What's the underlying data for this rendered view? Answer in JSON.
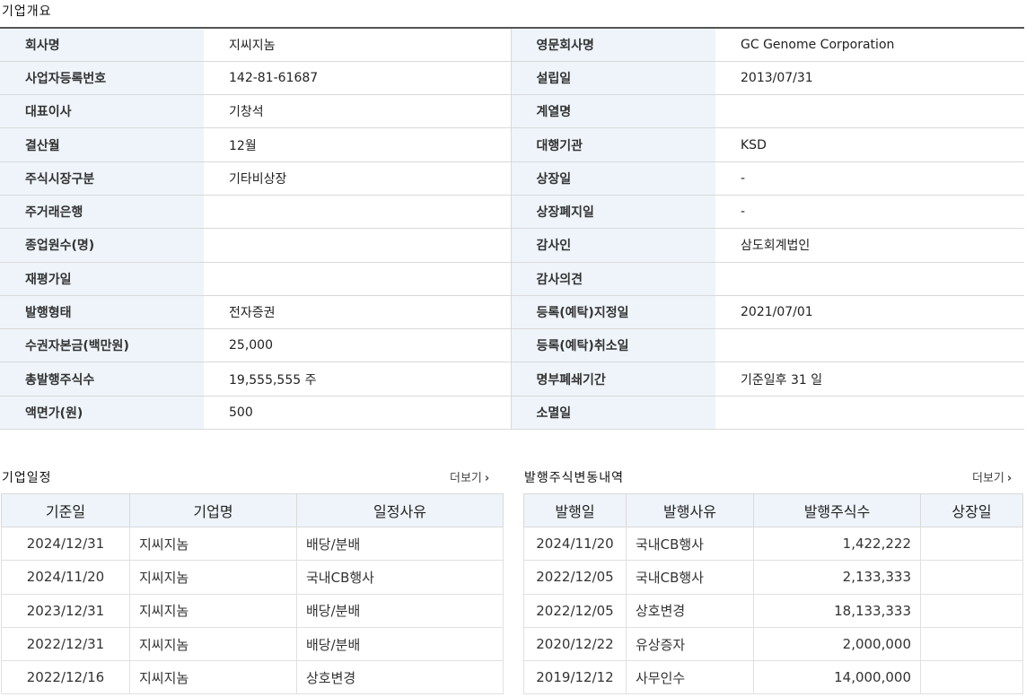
{
  "overview": {
    "title": "기업개요",
    "rows": [
      {
        "l1": "회사명",
        "v1": "지씨지놈",
        "l2": "영문회사명",
        "v2": "GC Genome Corporation"
      },
      {
        "l1": "사업자등록번호",
        "v1": "142-81-61687",
        "l2": "설립일",
        "v2": "2013/07/31"
      },
      {
        "l1": "대표이사",
        "v1": "기창석",
        "l2": "계열명",
        "v2": ""
      },
      {
        "l1": "결산월",
        "v1": "12월",
        "l2": "대행기관",
        "v2": "KSD"
      },
      {
        "l1": "주식시장구분",
        "v1": "기타비상장",
        "l2": "상장일",
        "v2": "-"
      },
      {
        "l1": "주거래은행",
        "v1": "",
        "l2": "상장폐지일",
        "v2": "-"
      },
      {
        "l1": "종업원수(명)",
        "v1": "",
        "l2": "감사인",
        "v2": "삼도회계법인"
      },
      {
        "l1": "재평가일",
        "v1": "",
        "l2": "감사의견",
        "v2": ""
      },
      {
        "l1": "발행형태",
        "v1": "전자증권",
        "l2": "등록(예탁)지정일",
        "v2": "2021/07/01"
      },
      {
        "l1": "수권자본금(백만원)",
        "v1": "25,000",
        "l2": "등록(예탁)취소일",
        "v2": ""
      },
      {
        "l1": "총발행주식수",
        "v1": "19,555,555 주",
        "l2": "명부폐쇄기간",
        "v2": "기준일후 31 일"
      },
      {
        "l1": "액면가(원)",
        "v1": "500",
        "l2": "소멸일",
        "v2": ""
      }
    ]
  },
  "schedule": {
    "title": "기업일정",
    "more_label": "더보기",
    "headers": [
      "기준일",
      "기업명",
      "일정사유"
    ],
    "rows": [
      [
        "2024/12/31",
        "지씨지놈",
        "배당/분배"
      ],
      [
        "2024/11/20",
        "지씨지놈",
        "국내CB행사"
      ],
      [
        "2023/12/31",
        "지씨지놈",
        "배당/분배"
      ],
      [
        "2022/12/31",
        "지씨지놈",
        "배당/분배"
      ],
      [
        "2022/12/16",
        "지씨지놈",
        "상호변경"
      ]
    ]
  },
  "shares": {
    "title": "발행주식변동내역",
    "more_label": "더보기",
    "headers": [
      "발행일",
      "발행사유",
      "발행주식수",
      "상장일"
    ],
    "rows": [
      [
        "2024/11/20",
        "국내CB행사",
        "1,422,222",
        ""
      ],
      [
        "2022/12/05",
        "국내CB행사",
        "2,133,333",
        ""
      ],
      [
        "2022/12/05",
        "상호변경",
        "18,133,333",
        ""
      ],
      [
        "2020/12/22",
        "유상증자",
        "2,000,000",
        ""
      ],
      [
        "2019/12/12",
        "사무인수",
        "14,000,000",
        ""
      ]
    ]
  }
}
